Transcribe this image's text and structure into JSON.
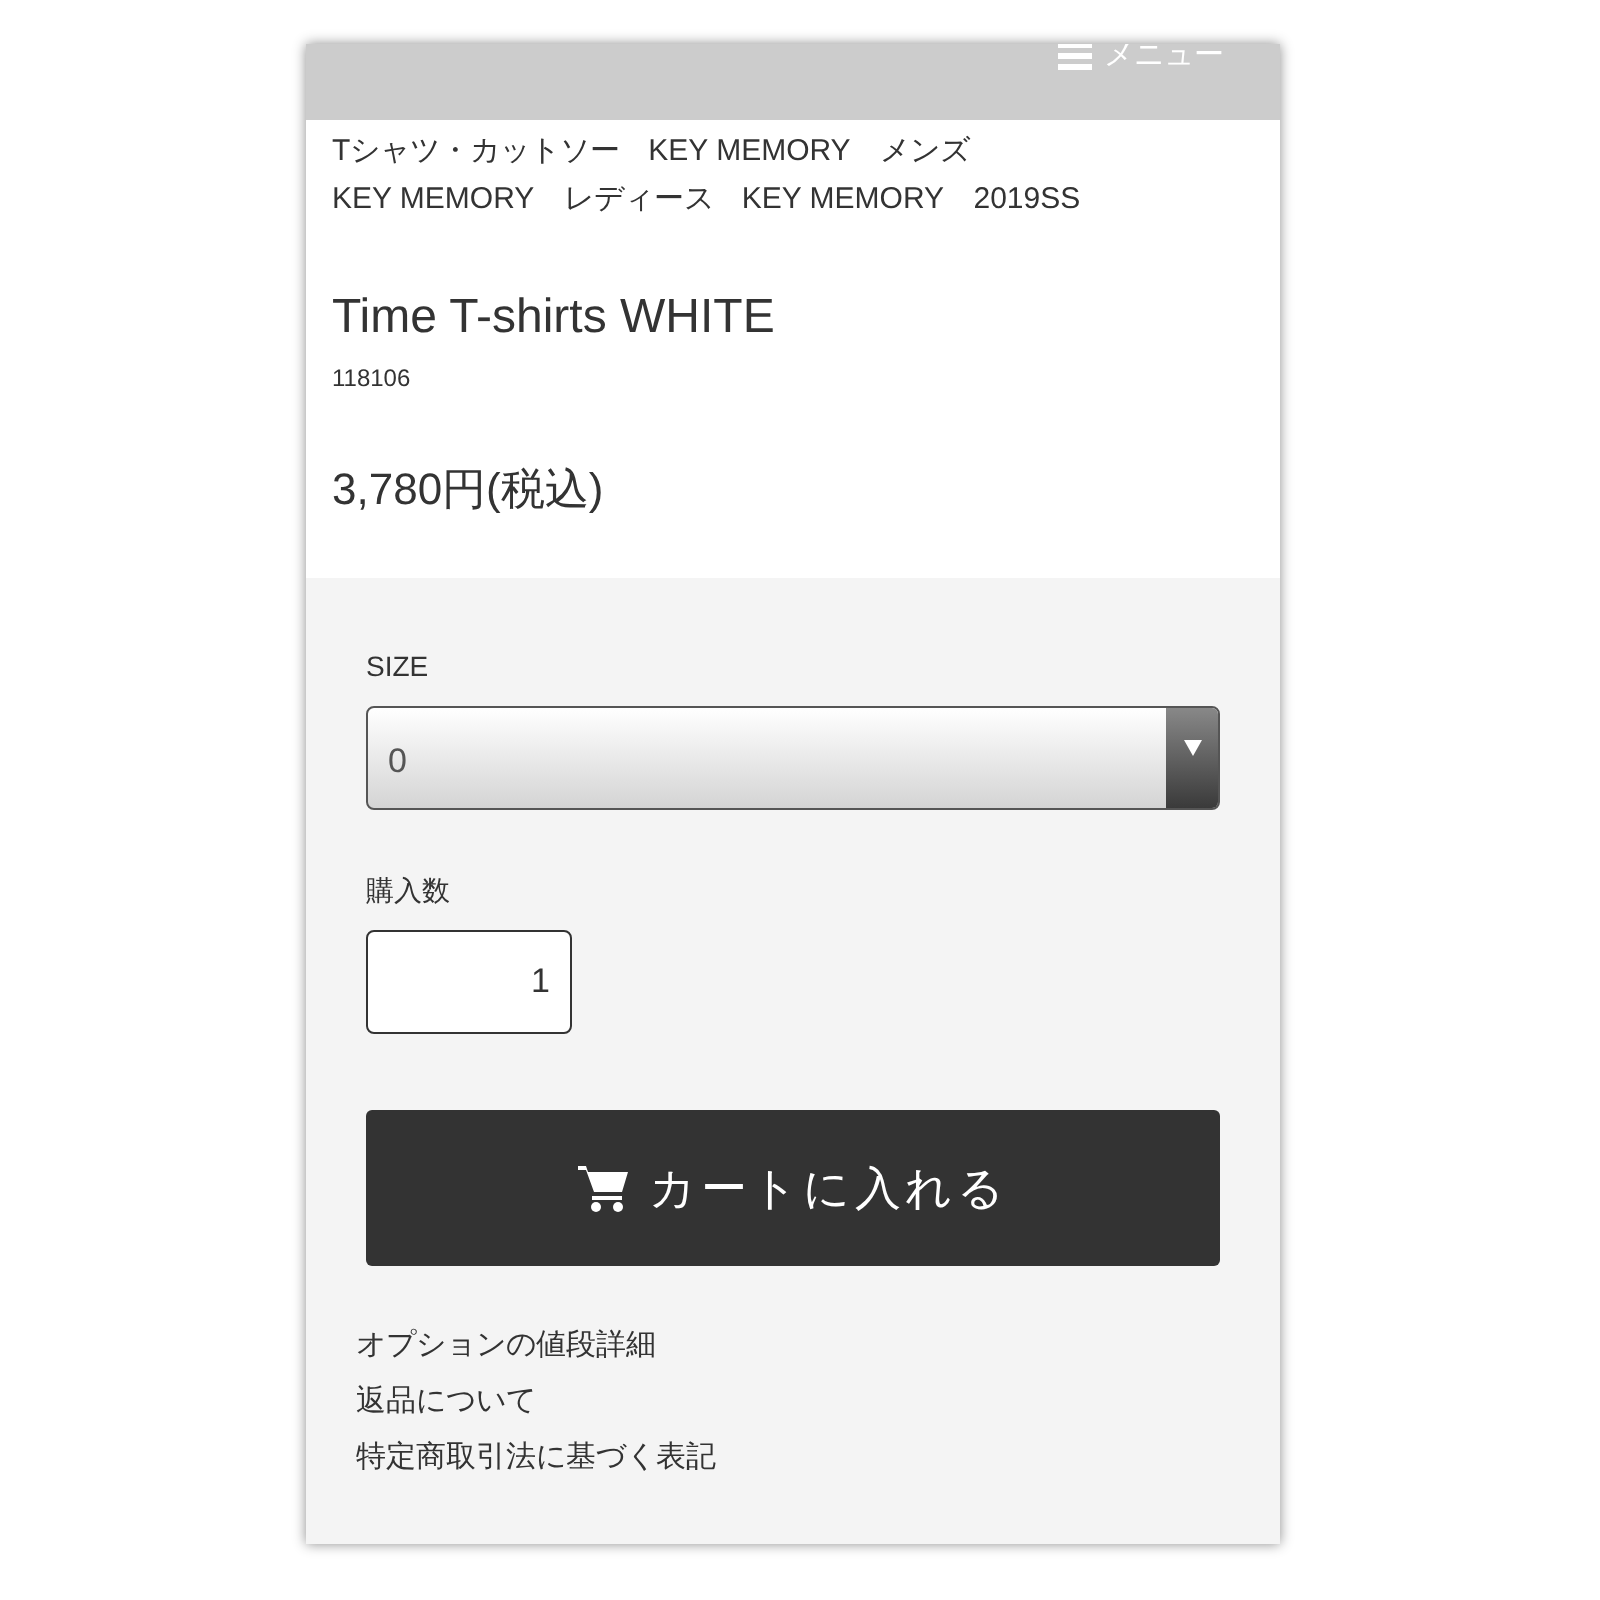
{
  "header": {
    "menu_label": "メニュー"
  },
  "categories": [
    "Tシャツ・カットソー",
    "KEY MEMORY　メンズ",
    "KEY MEMORY　レディース",
    "KEY MEMORY　2019SS"
  ],
  "product": {
    "title": "Time T-shirts WHITE",
    "code": "118106",
    "price": "3,780円(税込)"
  },
  "size": {
    "label": "SIZE",
    "value": "0"
  },
  "quantity": {
    "label": "購入数",
    "value": "1"
  },
  "cart_button": "カートに入れる",
  "links": [
    "オプションの値段詳細",
    "返品について",
    "特定商取引法に基づく表記"
  ]
}
